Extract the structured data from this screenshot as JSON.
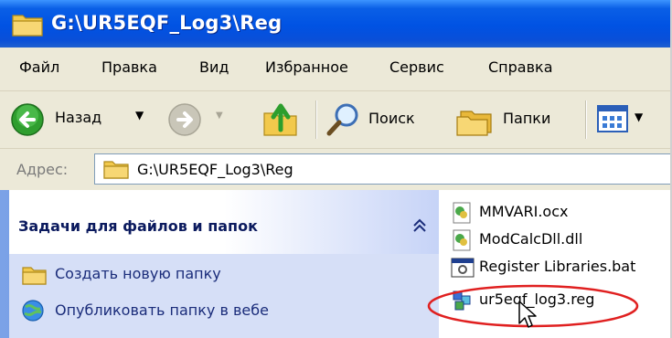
{
  "window": {
    "title": "G:\\UR5EQF_Log3\\Reg"
  },
  "menu": [
    "Файл",
    "Правка",
    "Вид",
    "Избранное",
    "Сервис",
    "Справка"
  ],
  "toolbar": {
    "back_label": "Назад",
    "search_label": "Поиск",
    "folders_label": "Папки"
  },
  "address": {
    "label": "Адрес:",
    "path": "G:\\UR5EQF_Log3\\Reg"
  },
  "task_pane": {
    "title": "Задачи для файлов и папок",
    "tasks": [
      "Создать новую папку",
      "Опубликовать папку в вебе"
    ]
  },
  "files": [
    {
      "name": "MMVARI.ocx",
      "icon": "activex-file-icon"
    },
    {
      "name": "ModCalcDll.dll",
      "icon": "dll-file-icon"
    },
    {
      "name": "Register Libraries.bat",
      "icon": "batch-file-icon"
    },
    {
      "name": "ur5eqf_log3.reg",
      "icon": "registry-file-icon",
      "highlighted": true
    }
  ],
  "colors": {
    "title_bar": "#0052e3",
    "chrome": "#ece9d8",
    "task_pane": "#6375d6",
    "highlight_ellipse": "#e02020"
  }
}
